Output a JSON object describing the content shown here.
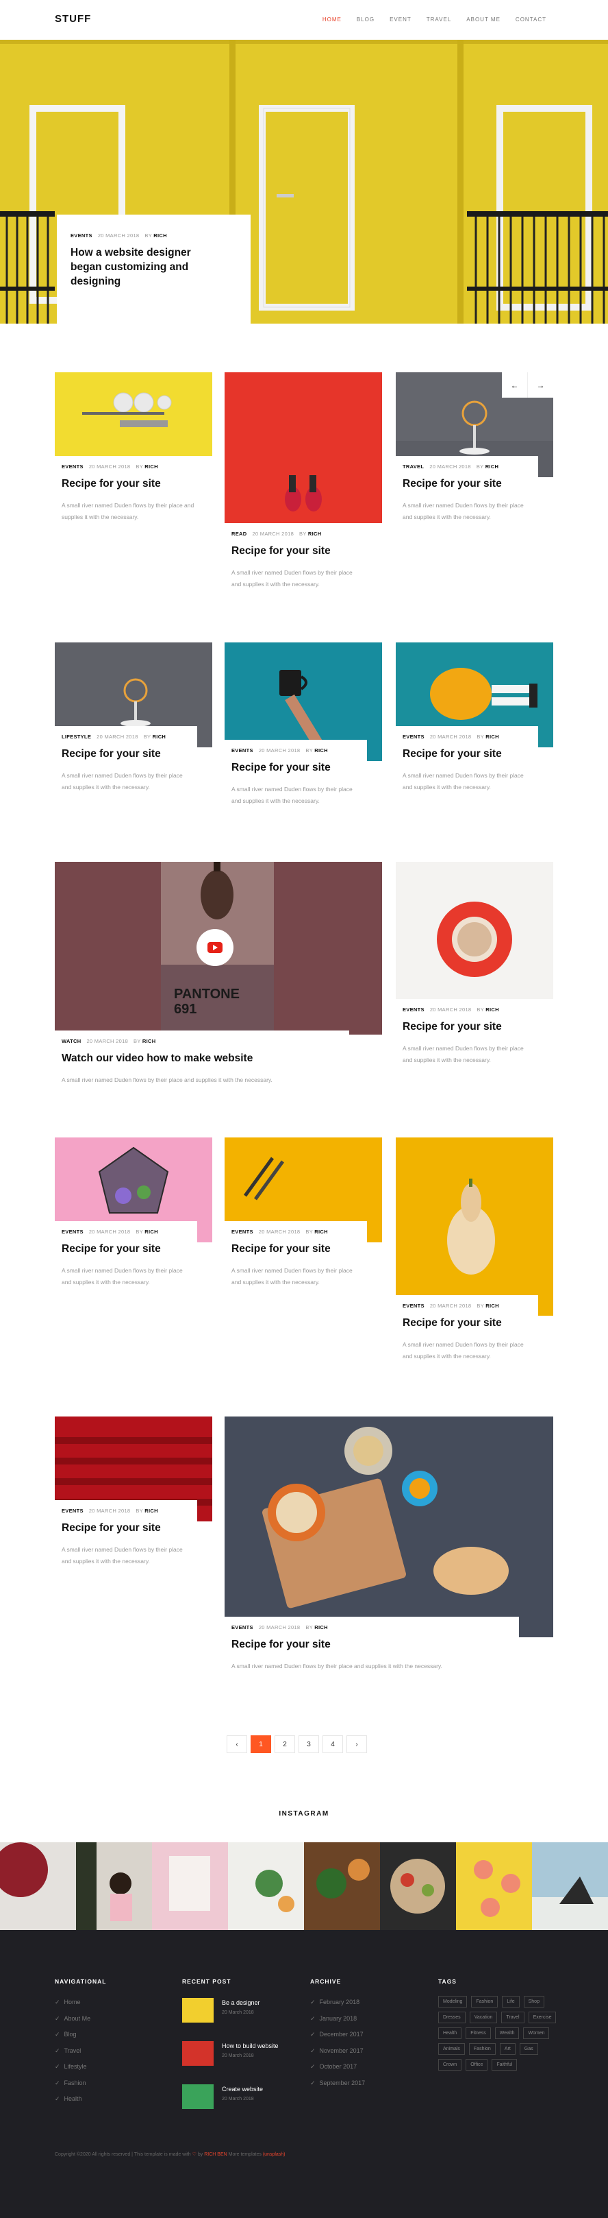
{
  "brand": "STUFF",
  "nav": {
    "items": [
      "HOME",
      "BLOG",
      "EVENT",
      "TRAVEL",
      "ABOUT ME",
      "CONTACT"
    ]
  },
  "hero": {
    "category": "EVENTS",
    "date": "20 MARCH 2018",
    "by": "BY",
    "author": "RICH",
    "title": "How a website designer began customizing and designing"
  },
  "carousel": {
    "prev": "←",
    "next": "→"
  },
  "posts": [
    {
      "category": "EVENTS",
      "date": "20 MARCH 2018",
      "by": "BY",
      "author": "RICH",
      "title": "Recipe for your site",
      "excerpt": "A small river named Duden flows by their place and supplies it with the necessary."
    },
    {
      "category": "READ",
      "date": "20 MARCH 2018",
      "by": "BY",
      "author": "RICH",
      "title": "Recipe for your site",
      "excerpt": "A small river named Duden flows by their place and supplies it with the necessary."
    },
    {
      "category": "TRAVEL",
      "date": "20 MARCH 2018",
      "by": "BY",
      "author": "RICH",
      "title": "Recipe for your site",
      "excerpt": "A small river named Duden flows by their place and supplies it with the necessary."
    },
    {
      "category": "LIFESTYLE",
      "date": "20 MARCH 2018",
      "by": "BY",
      "author": "RICH",
      "title": "Recipe for your site",
      "excerpt": "A small river named Duden flows by their place and supplies it with the necessary."
    },
    {
      "category": "EVENTS",
      "date": "20 MARCH 2018",
      "by": "BY",
      "author": "RICH",
      "title": "Recipe for your site",
      "excerpt": "A small river named Duden flows by their place and supplies it with the necessary."
    },
    {
      "category": "EVENTS",
      "date": "20 MARCH 2018",
      "by": "BY",
      "author": "RICH",
      "title": "Recipe for your site",
      "excerpt": "A small river named Duden flows by their place and supplies it with the necessary."
    },
    {
      "category": "WATCH",
      "date": "20 MARCH 2018",
      "by": "BY",
      "author": "RICH",
      "title": "Watch our video how to make website",
      "excerpt": "A small river named Duden flows by their place and supplies it with the necessary."
    },
    {
      "category": "EVENTS",
      "date": "20 MARCH 2018",
      "by": "BY",
      "author": "RICH",
      "title": "Recipe for your site",
      "excerpt": "A small river named Duden flows by their place and supplies it with the necessary."
    },
    {
      "category": "EVENTS",
      "date": "20 MARCH 2018",
      "by": "BY",
      "author": "RICH",
      "title": "Recipe for your site",
      "excerpt": "A small river named Duden flows by their place and supplies it with the necessary."
    },
    {
      "category": "EVENTS",
      "date": "20 MARCH 2018",
      "by": "BY",
      "author": "RICH",
      "title": "Recipe for your site",
      "excerpt": "A small river named Duden flows by their place and supplies it with the necessary."
    },
    {
      "category": "EVENTS",
      "date": "20 MARCH 2018",
      "by": "BY",
      "author": "RICH",
      "title": "Recipe for your site",
      "excerpt": "A small river named Duden flows by their place and supplies it with the necessary."
    },
    {
      "category": "EVENTS",
      "date": "20 MARCH 2018",
      "by": "BY",
      "author": "RICH",
      "title": "Recipe for your site",
      "excerpt": "A small river named Duden flows by their place and supplies it with the necessary."
    },
    {
      "category": "EVENTS",
      "date": "20 MARCH 2018",
      "by": "BY",
      "author": "RICH",
      "title": "Recipe for your site",
      "excerpt": "A small river named Duden flows by their place and supplies it with the necessary."
    }
  ],
  "video": {
    "text1": "PANTONE",
    "text2": "691"
  },
  "pagination": [
    "‹",
    "1",
    "2",
    "3",
    "4",
    "›"
  ],
  "instagram": {
    "title": "INSTAGRAM"
  },
  "footer": {
    "nav_title": "NAVIGATIONAL",
    "nav_items": [
      "Home",
      "About Me",
      "Blog",
      "Travel",
      "Lifestyle",
      "Fashion",
      "Health"
    ],
    "recent_title": "RECENT POST",
    "recent": [
      {
        "title": "Be a designer",
        "date": "20 March 2018"
      },
      {
        "title": "How to build website",
        "date": "20 March 2018"
      },
      {
        "title": "Create website",
        "date": "20 March 2018"
      }
    ],
    "archive_title": "ARCHIVE",
    "archive": [
      "February 2018",
      "January 2018",
      "December 2017",
      "November 2017",
      "October 2017",
      "September 2017"
    ],
    "tags_title": "TAGS",
    "tags": [
      "Modeling",
      "Fashion",
      "Life",
      "Shop",
      "Dresses",
      "Vacation",
      "Travel",
      "Exercise",
      "Health",
      "Fitness",
      "Wealth",
      "Women",
      "Animals",
      "Fashion",
      "Art",
      "Gas",
      "Crown",
      "Office",
      "Faithful"
    ],
    "copyright": "Copyright ©2020 All rights reserved | This template is made with",
    "by": "by",
    "studio": "RICH BEN",
    "more": "More templates",
    "source": "(unsplash)"
  }
}
